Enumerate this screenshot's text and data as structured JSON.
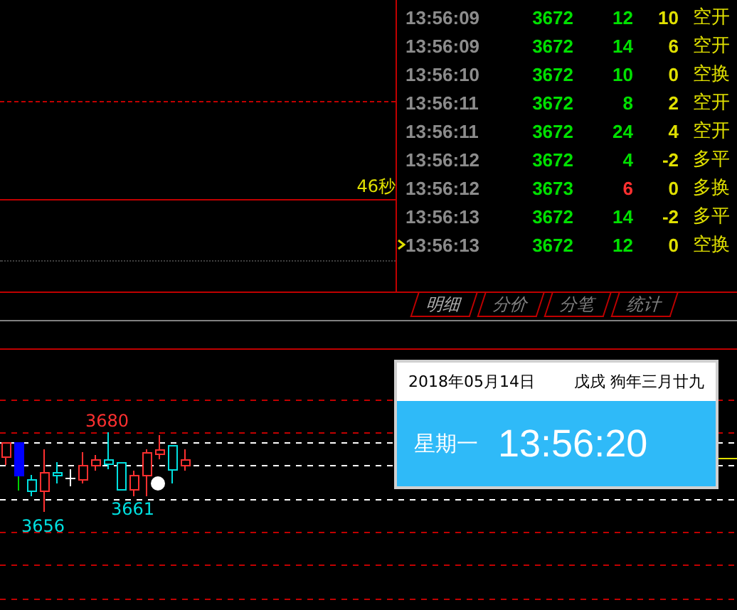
{
  "upper_chart": {
    "countdown": "46秒"
  },
  "ticks": [
    {
      "time": "13:56:09",
      "price": "3672",
      "volume": "12",
      "color": "#00e000",
      "change": "10",
      "type": "空开",
      "current": false
    },
    {
      "time": "13:56:09",
      "price": "3672",
      "volume": "14",
      "color": "#00e000",
      "change": "6",
      "type": "空开",
      "current": false
    },
    {
      "time": "13:56:10",
      "price": "3672",
      "volume": "10",
      "color": "#00e000",
      "change": "0",
      "type": "空换",
      "current": false
    },
    {
      "time": "13:56:11",
      "price": "3672",
      "volume": "8",
      "color": "#00e000",
      "change": "2",
      "type": "空开",
      "current": false
    },
    {
      "time": "13:56:11",
      "price": "3672",
      "volume": "24",
      "color": "#00e000",
      "change": "4",
      "type": "空开",
      "current": false
    },
    {
      "time": "13:56:12",
      "price": "3672",
      "volume": "4",
      "color": "#00e000",
      "change": "-2",
      "type": "多平",
      "current": false
    },
    {
      "time": "13:56:12",
      "price": "3673",
      "volume": "6",
      "color": "#ff3030",
      "change": "0",
      "type": "多换",
      "current": false
    },
    {
      "time": "13:56:13",
      "price": "3672",
      "volume": "14",
      "color": "#00e000",
      "change": "-2",
      "type": "多平",
      "current": false
    },
    {
      "time": "13:56:13",
      "price": "3672",
      "volume": "12",
      "color": "#00e000",
      "change": "0",
      "type": "空换",
      "current": true
    }
  ],
  "tabs": [
    {
      "label": "明细",
      "selected": true
    },
    {
      "label": "分价",
      "selected": false
    },
    {
      "label": "分笔",
      "selected": false
    },
    {
      "label": "统计",
      "selected": false
    }
  ],
  "lower_chart": {
    "high_label": "3680",
    "low_label": "3656",
    "mid_label": "3661"
  },
  "clock_popup": {
    "date": "2018年05月14日",
    "lunar": "戊戌 狗年三月廿九",
    "weekday": "星期一",
    "time": "13:56:20"
  }
}
